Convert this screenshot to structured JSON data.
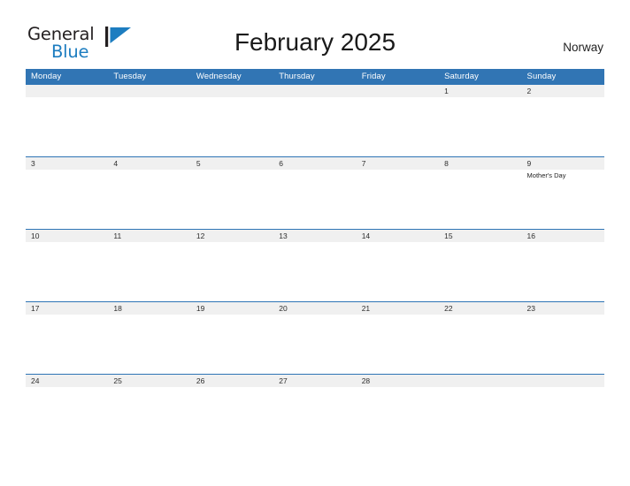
{
  "brand": {
    "name_part1": "General",
    "name_part2": "Blue",
    "mark": "flag-triangle-icon",
    "accent_color": "#1d7dc0"
  },
  "header": {
    "title": "February 2025",
    "country": "Norway"
  },
  "theme": {
    "header_blue": "#3175b4",
    "row_divider_blue": "#2e74b5",
    "date_band_gray": "#f0f0f0",
    "text_dark": "#231f20"
  },
  "calendar": {
    "weekdays": [
      "Monday",
      "Tuesday",
      "Wednesday",
      "Thursday",
      "Friday",
      "Saturday",
      "Sunday"
    ],
    "weeks": [
      [
        {
          "day": "",
          "events": []
        },
        {
          "day": "",
          "events": []
        },
        {
          "day": "",
          "events": []
        },
        {
          "day": "",
          "events": []
        },
        {
          "day": "",
          "events": []
        },
        {
          "day": "1",
          "events": []
        },
        {
          "day": "2",
          "events": []
        }
      ],
      [
        {
          "day": "3",
          "events": []
        },
        {
          "day": "4",
          "events": []
        },
        {
          "day": "5",
          "events": []
        },
        {
          "day": "6",
          "events": []
        },
        {
          "day": "7",
          "events": []
        },
        {
          "day": "8",
          "events": []
        },
        {
          "day": "9",
          "events": [
            "Mother's Day"
          ]
        }
      ],
      [
        {
          "day": "10",
          "events": []
        },
        {
          "day": "11",
          "events": []
        },
        {
          "day": "12",
          "events": []
        },
        {
          "day": "13",
          "events": []
        },
        {
          "day": "14",
          "events": []
        },
        {
          "day": "15",
          "events": []
        },
        {
          "day": "16",
          "events": []
        }
      ],
      [
        {
          "day": "17",
          "events": []
        },
        {
          "day": "18",
          "events": []
        },
        {
          "day": "19",
          "events": []
        },
        {
          "day": "20",
          "events": []
        },
        {
          "day": "21",
          "events": []
        },
        {
          "day": "22",
          "events": []
        },
        {
          "day": "23",
          "events": []
        }
      ],
      [
        {
          "day": "24",
          "events": []
        },
        {
          "day": "25",
          "events": []
        },
        {
          "day": "26",
          "events": []
        },
        {
          "day": "27",
          "events": []
        },
        {
          "day": "28",
          "events": []
        },
        {
          "day": "",
          "events": []
        },
        {
          "day": "",
          "events": []
        }
      ]
    ]
  }
}
